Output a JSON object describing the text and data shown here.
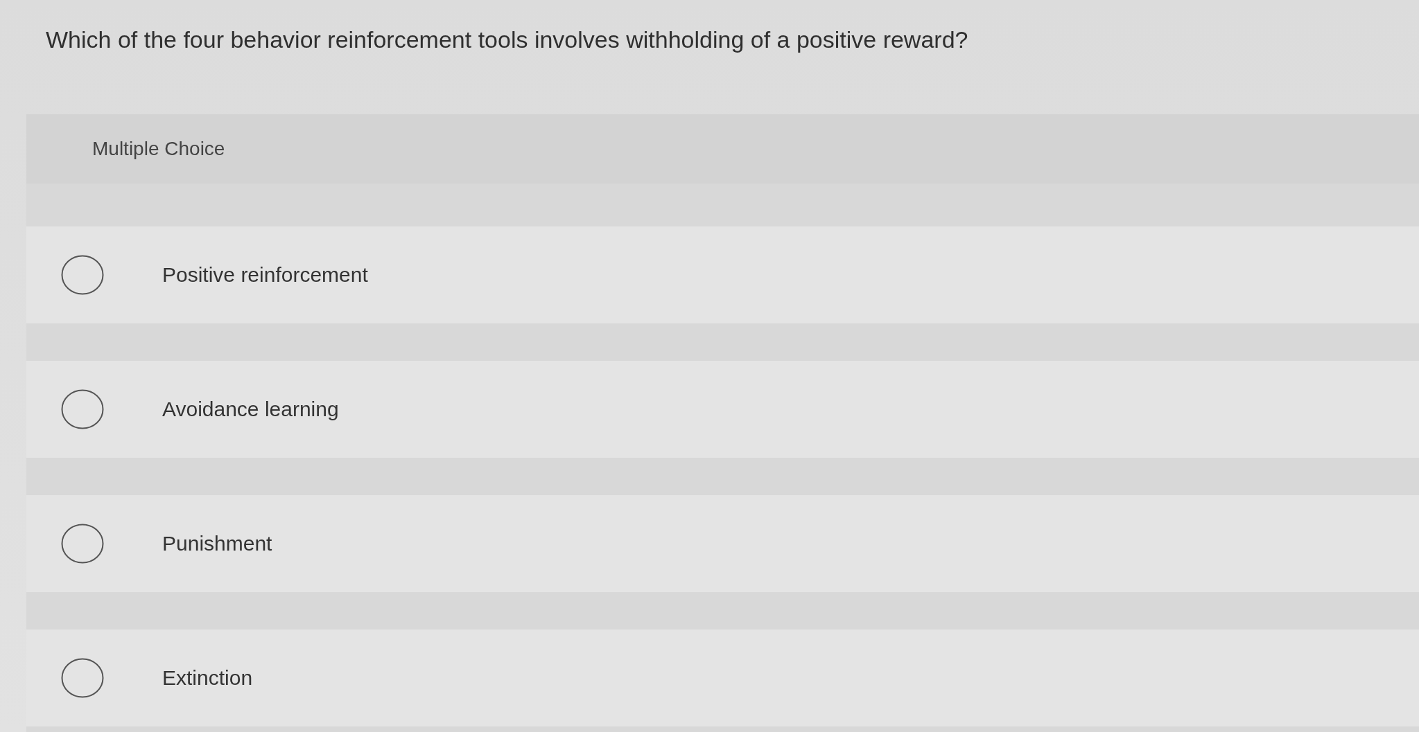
{
  "question": "Which of the four behavior reinforcement tools involves withholding of a positive reward?",
  "answer_panel": {
    "label": "Multiple Choice",
    "options": [
      {
        "label": "Positive reinforcement",
        "selected": false
      },
      {
        "label": "Avoidance learning",
        "selected": false
      },
      {
        "label": "Punishment",
        "selected": false
      },
      {
        "label": "Extinction",
        "selected": false
      }
    ]
  }
}
